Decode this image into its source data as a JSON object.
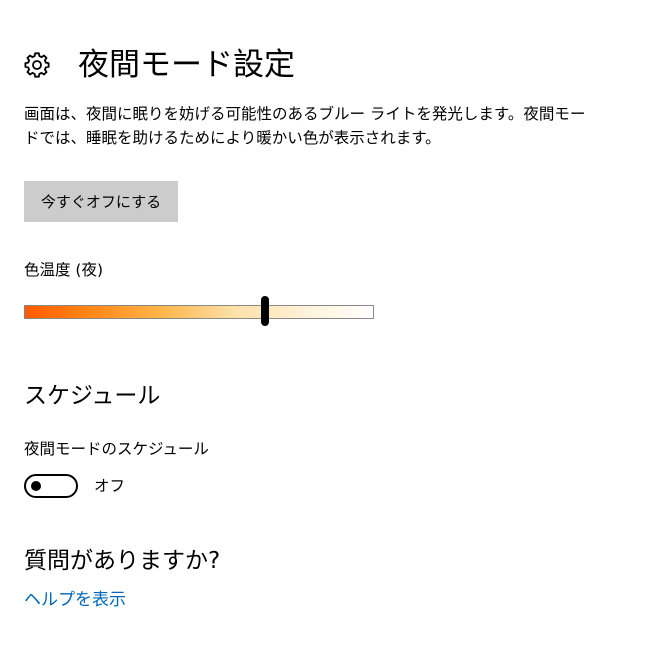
{
  "header": {
    "icon": "gear-icon",
    "title": "夜間モード設定"
  },
  "description": "画面は、夜間に眠りを妨げる可能性のあるブルー ライトを発光します。夜間モードでは、睡眠を助けるためにより暖かい色が表示されます。",
  "turn_off_button": {
    "label": "今すぐオフにする"
  },
  "color_temperature": {
    "label": "色温度 (夜)",
    "value_fraction": 0.69,
    "gradient_colors": [
      "#ff5a00",
      "#ff8a1a",
      "#ffb84d",
      "#ffe0a8",
      "#fff2d8",
      "#ffffff"
    ]
  },
  "schedule": {
    "title": "スケジュール",
    "label": "夜間モードのスケジュール",
    "toggle_on": false,
    "state_label": "オフ"
  },
  "help": {
    "title": "質問がありますか?",
    "link_label": "ヘルプを表示",
    "link_color": "#0067b8"
  }
}
